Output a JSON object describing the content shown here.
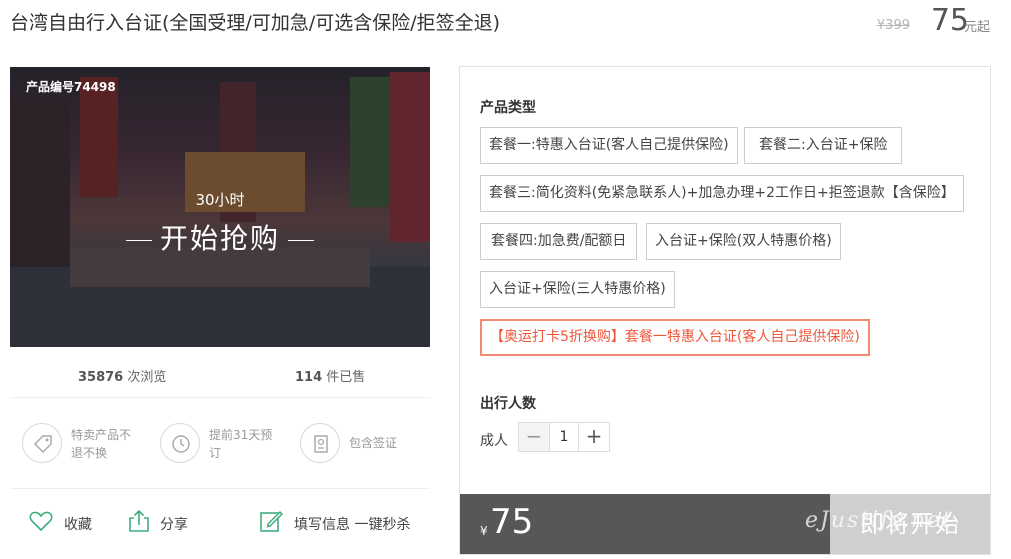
{
  "header": {
    "title": "台湾自由行入台证(全国受理/可加急/可选含保险/拒签全退)",
    "original_price": "¥399",
    "price": "75",
    "price_unit": "元起"
  },
  "hero": {
    "product_code": "产品编号74498",
    "countdown": "30小时",
    "start_label": "开始抢购"
  },
  "stats": {
    "views_count": "35876",
    "views_label": "次浏览",
    "sold_count": "114",
    "sold_label": "件已售"
  },
  "features": [
    {
      "icon": "tag-icon",
      "text": "特卖产品不退不换"
    },
    {
      "icon": "clock-icon",
      "text": "提前31天预订"
    },
    {
      "icon": "passport-icon",
      "text": "包含签证"
    }
  ],
  "actions": {
    "favorite": "收藏",
    "share": "分享",
    "quick_fill": "填写信息 一键秒杀"
  },
  "panel": {
    "product_type_title": "产品类型",
    "options": [
      "套餐一:特惠入台证(客人自己提供保险)",
      "套餐二:入台证+保险",
      "套餐三:简化资料(免紧急联系人)+加急办理+2工作日+拒签退款【含保险】",
      "套餐四:加急费/配额日",
      "入台证+保险(双人特惠价格)",
      "入台证+保险(三人特惠价格)",
      "【奥运打卡5折换购】套餐一特惠入台证(客人自己提供保险)"
    ],
    "travelers_title": "出行人数",
    "adult_label": "成人",
    "adult_count": "1",
    "minus": "−",
    "plus": "+"
  },
  "buybar": {
    "currency": "¥",
    "amount": "75",
    "button_label": "即将开始"
  },
  "watermark": "eJustify.net",
  "colors": {
    "highlight_border": "#f08a74",
    "highlight_text": "#f0563a",
    "buybar_bg": "#575757",
    "button_bg": "#cfcfcf",
    "icon_green": "#3fae7f"
  }
}
